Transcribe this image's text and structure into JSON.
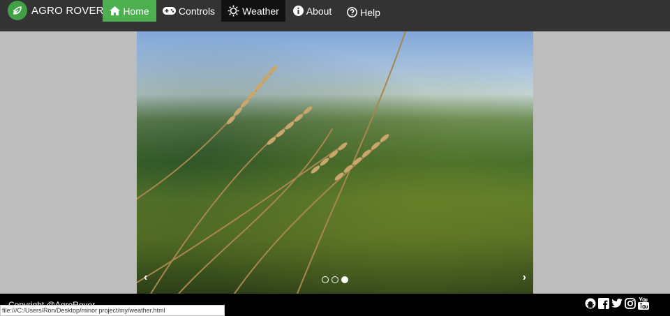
{
  "brand": {
    "name": "AGRO ROVER",
    "logo_icon": "leaf-icon"
  },
  "nav": {
    "home": {
      "label": "Home",
      "icon": "home-icon"
    },
    "controls": {
      "label": "Controls",
      "icon": "gamepad-icon"
    },
    "weather": {
      "label": "Weather",
      "icon": "sun-icon"
    },
    "about": {
      "label": "About",
      "icon": "info-icon"
    },
    "help": {
      "label": "Help",
      "icon": "question-icon"
    }
  },
  "carousel": {
    "prev_label": "‹",
    "next_label": "›",
    "slide_count": 3,
    "active_slide": 3,
    "image_subject": "wheat stalks in a green field"
  },
  "footer": {
    "copyright": "Copyright @AgroRover",
    "socials": [
      "github-icon",
      "facebook-icon",
      "twitter-icon",
      "instagram-icon",
      "youtube-icon"
    ]
  },
  "statusbar": {
    "url": "file:///C:/Users/Ron/Desktop/minor project/my/weather.html"
  },
  "colors": {
    "navbar": "#333333",
    "active_home": "#4caf50",
    "weather_tab": "#111111",
    "page_bg": "#bdbdbd",
    "footer": "#000000"
  }
}
